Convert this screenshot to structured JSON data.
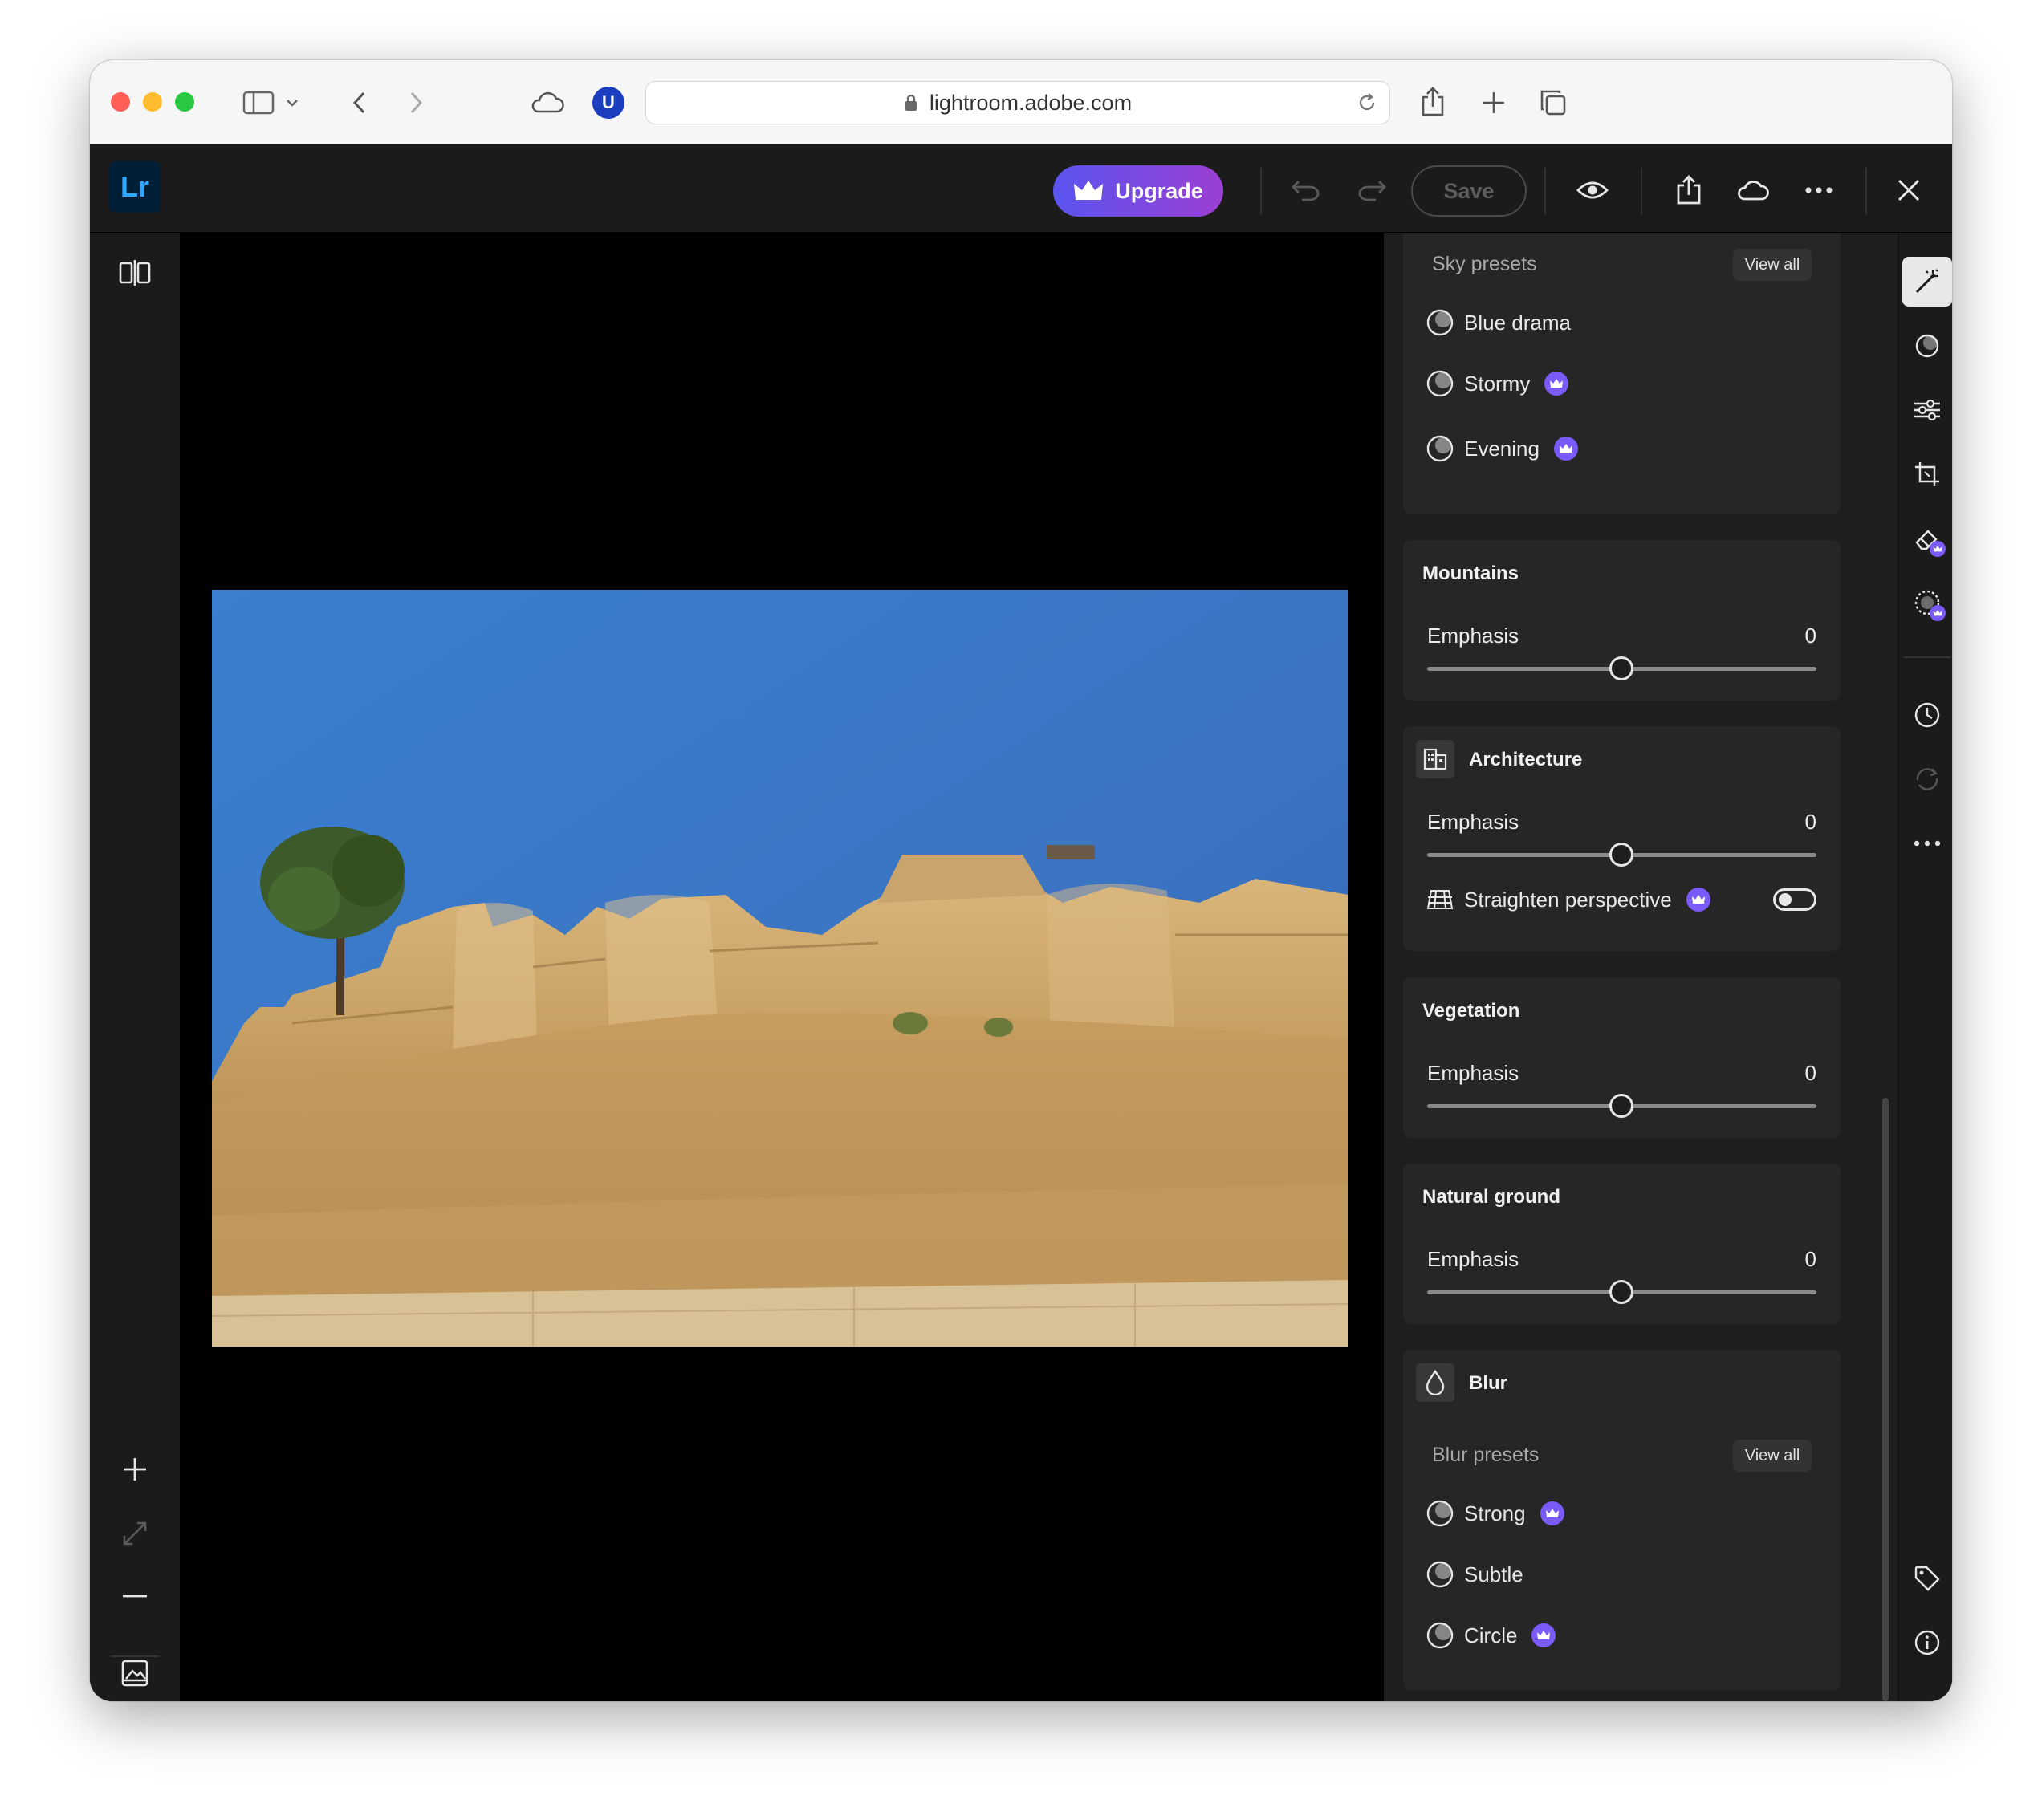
{
  "browser": {
    "url": "lightroom.adobe.com",
    "extension_badge": "U"
  },
  "app": {
    "logo": "Lr",
    "upgrade_label": "Upgrade",
    "save_label": "Save"
  },
  "panel": {
    "sky": {
      "presets_heading": "Sky presets",
      "view_all": "View all",
      "presets": [
        {
          "label": "Blue drama",
          "premium": false
        },
        {
          "label": "Stormy",
          "premium": true
        },
        {
          "label": "Evening",
          "premium": true
        }
      ]
    },
    "mountains": {
      "title": "Mountains",
      "emphasis_label": "Emphasis",
      "emphasis_value": "0"
    },
    "architecture": {
      "title": "Architecture",
      "emphasis_label": "Emphasis",
      "emphasis_value": "0",
      "straighten_label": "Straighten perspective",
      "straighten_on": false
    },
    "vegetation": {
      "title": "Vegetation",
      "emphasis_label": "Emphasis",
      "emphasis_value": "0"
    },
    "natural_ground": {
      "title": "Natural ground",
      "emphasis_label": "Emphasis",
      "emphasis_value": "0"
    },
    "blur": {
      "title": "Blur",
      "presets_heading": "Blur presets",
      "view_all": "View all",
      "presets": [
        {
          "label": "Strong",
          "premium": true
        },
        {
          "label": "Subtle",
          "premium": false
        },
        {
          "label": "Circle",
          "premium": true
        }
      ]
    }
  },
  "colors": {
    "accent_purple": "#7a5af8",
    "upgrade_gradient_start": "#5a54f0",
    "upgrade_gradient_end": "#9b3fd1",
    "lr_logo_bg": "#001e36",
    "lr_logo_text": "#31a8ff"
  },
  "icons": {
    "tool_rail": [
      "magic-wand-icon",
      "presets-icon",
      "edit-sliders-icon",
      "crop-icon",
      "eraser-icon",
      "masking-icon",
      "history-icon",
      "versions-icon",
      "more-icon",
      "tag-icon",
      "info-icon"
    ],
    "left_rail": [
      "compare-icon",
      "zoom-in-icon",
      "fit-icon",
      "zoom-out-icon",
      "filmstrip-icon"
    ]
  }
}
